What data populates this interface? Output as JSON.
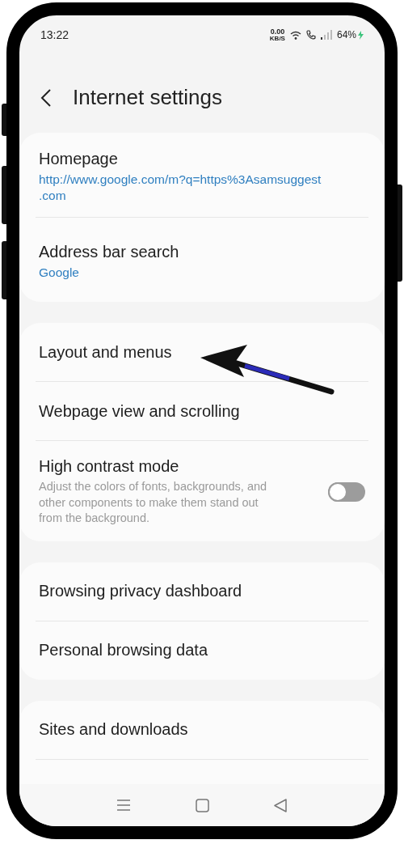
{
  "status_bar": {
    "time": "13:22",
    "net_speed": "0.00",
    "net_unit": "KB/S",
    "battery": "64%"
  },
  "header": {
    "title": "Internet settings"
  },
  "groups": [
    {
      "items": [
        {
          "kind": "value",
          "title": "Homepage",
          "value": "http://www.google.com/m?q=https%3Asamsuggest\n.com"
        },
        {
          "kind": "value",
          "title": "Address bar search",
          "value": "Google"
        }
      ]
    },
    {
      "items": [
        {
          "kind": "link",
          "title": "Layout and menus"
        },
        {
          "kind": "link",
          "title": "Webpage view and scrolling"
        },
        {
          "kind": "switch",
          "title": "High contrast mode",
          "description": "Adjust the colors of fonts, backgrounds, and other components to make them stand out from the background.",
          "on": false
        }
      ]
    },
    {
      "items": [
        {
          "kind": "link",
          "title": "Browsing privacy dashboard"
        },
        {
          "kind": "link",
          "title": "Personal browsing data"
        }
      ]
    },
    {
      "items": [
        {
          "kind": "link",
          "title": "Sites and downloads"
        },
        {
          "kind": "cut"
        }
      ]
    }
  ]
}
